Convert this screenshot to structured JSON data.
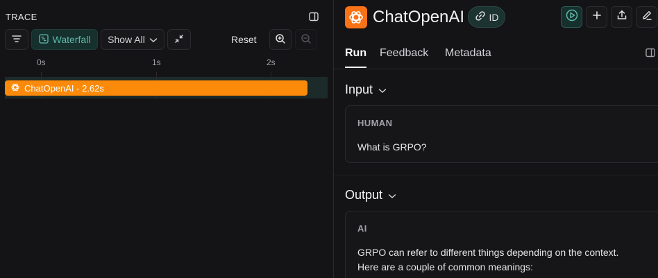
{
  "trace": {
    "title": "TRACE",
    "toolbar": {
      "waterfall_label": "Waterfall",
      "show_all_label": "Show All",
      "reset_label": "Reset"
    },
    "axis_ticks": [
      "0s",
      "1s",
      "2s"
    ],
    "run": {
      "label": "ChatOpenAI - 2.62s",
      "bar_color": "#fb8a0a"
    }
  },
  "detail": {
    "title": "ChatOpenAI",
    "id_badge": "ID",
    "accent": "#f97316",
    "tabs": [
      {
        "label": "Run"
      },
      {
        "label": "Feedback"
      },
      {
        "label": "Metadata"
      }
    ],
    "input": {
      "heading": "Input",
      "role": "HUMAN",
      "message": "What is GRPO?"
    },
    "output": {
      "heading": "Output",
      "role": "AI",
      "message_line1": "GRPO can refer to different things depending on the context.",
      "message_line2": "Here are a couple of common meanings:"
    }
  },
  "icons": [
    "panel-toggle-icon",
    "filter-icon",
    "waterfall-icon",
    "chevron-down-icon",
    "collapse-icon",
    "zoom-in-icon",
    "zoom-out-icon",
    "openai-icon",
    "link-icon",
    "play-icon",
    "plus-icon",
    "upload-icon",
    "edit-icon",
    "side-panel-icon"
  ]
}
